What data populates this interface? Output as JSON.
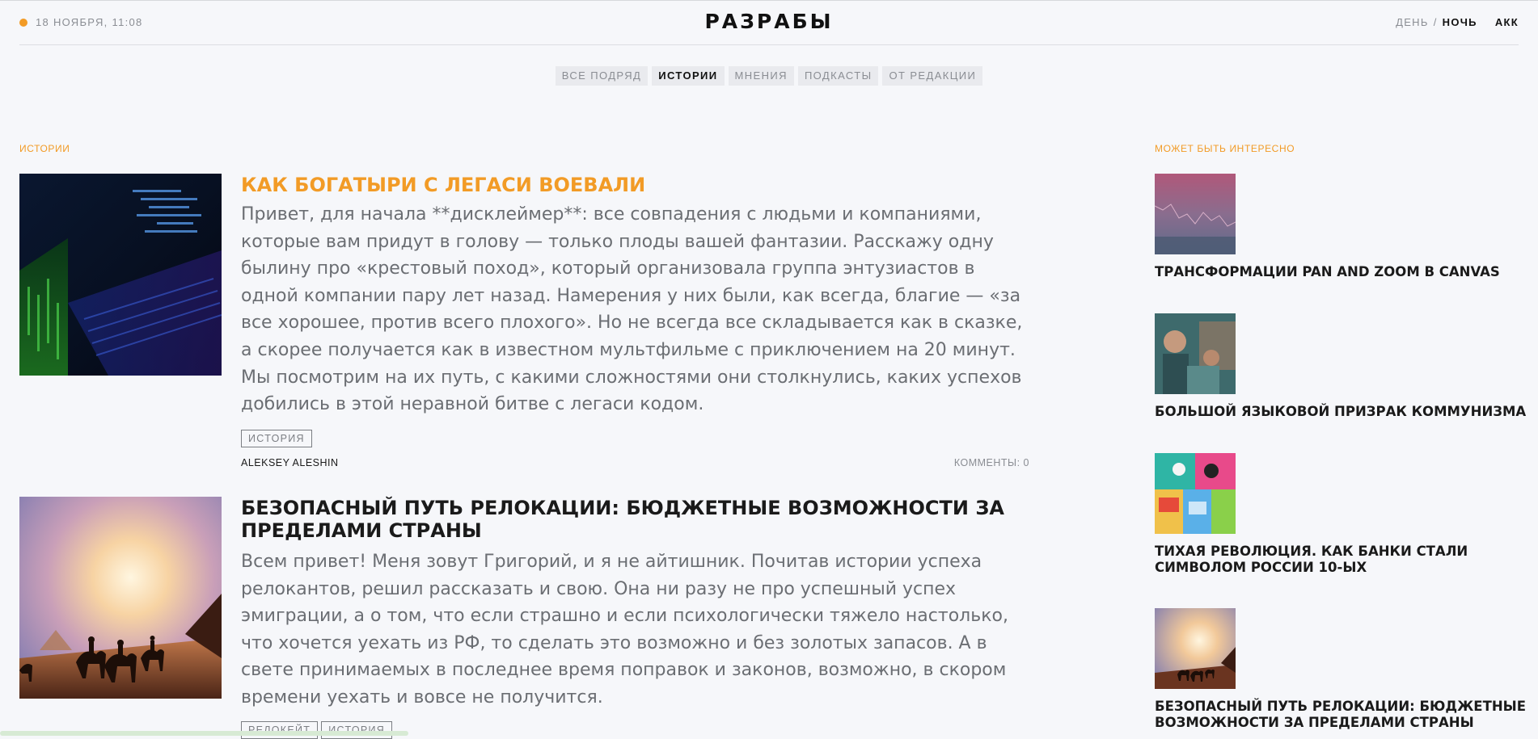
{
  "header": {
    "date": "18 НОЯБРЯ, 11:08",
    "logo": "РАЗРАБЫ",
    "theme_day": "ДЕНЬ",
    "theme_separator": "/",
    "theme_night": "НОЧЬ",
    "account": "АКК"
  },
  "tabs": [
    {
      "label": "ВСЕ ПОДРЯД"
    },
    {
      "label": "ИСТОРИИ"
    },
    {
      "label": "МНЕНИЯ"
    },
    {
      "label": "ПОДКАСТЫ"
    },
    {
      "label": "ОТ РЕДАКЦИИ"
    }
  ],
  "active_tab": "ИСТОРИИ",
  "main": {
    "section_label": "ИСТОРИИ",
    "articles": [
      {
        "title": "КАК БОГАТЫРИ С ЛЕГАСИ ВОЕВАЛИ",
        "text": "Привет, для начала **дисклеймер**: все совпадения с людьми и компаниями, которые вам придут в голову — только плоды вашей фантазии. Расскажу одну былину про «крестовый поход», который организовала группа энтузиастов в одной компании пару лет назад. Намерения у них были, как всегда, благие — «за все хорошее, против всего плохого». Но не всегда все складывается как в сказке, а скорее получается как в известном мультфильме с приключением на 20 минут. Мы посмотрим на их путь, с какими сложностями они столкнулись, каких успехов добились в этой неравной битве с легаси кодом.",
        "tags": [
          "ИСТОРИЯ"
        ],
        "author": "ALEKSEY ALESHIN",
        "comments": "КОММЕНТЫ: 0"
      },
      {
        "title": "БЕЗОПАСНЫЙ ПУТЬ РЕЛОКАЦИИ: БЮДЖЕТНЫЕ ВОЗМОЖНОСТИ ЗА ПРЕДЕЛАМИ СТРАНЫ",
        "text": "Всем привет! Меня зовут Григорий, и я не айтишник. Почитав истории успеха релокантов, решил рассказать и свою. Она ни разу не про успешный успех эмиграции, а о том, что если страшно и если психологически тяжело настолько, что хочется уехать из РФ, то сделать это возможно и без золотых запасов. А в свете принимаемых в последнее время поправок и законов, возможно, в скором времени уехать и вовсе не получится.",
        "tags": [
          "РЕЛОКЕЙТ",
          "ИСТОРИЯ"
        ]
      }
    ]
  },
  "sidebar": {
    "label": "МОЖЕТ БЫТЬ ИНТЕРЕСНО",
    "items": [
      {
        "title": "ТРАНСФОРМАЦИИ PAN AND ZOOM В CANVAS"
      },
      {
        "title": "БОЛЬШОЙ ЯЗЫКОВОЙ ПРИЗРАК КОММУНИЗМА"
      },
      {
        "title": "ТИХАЯ РЕВОЛЮЦИЯ. КАК БАНКИ СТАЛИ СИМВОЛОМ РОССИИ 10-ЫХ"
      },
      {
        "title": "БЕЗОПАСНЫЙ ПУТЬ РЕЛОКАЦИИ: БЮДЖЕТНЫЕ ВОЗМОЖНОСТИ ЗА ПРЕДЕЛАМИ СТРАНЫ"
      }
    ]
  },
  "colors": {
    "accent": "#f29b26",
    "background": "#f6f7fa",
    "text": "#1a1a1a",
    "muted": "#8a8d93"
  }
}
